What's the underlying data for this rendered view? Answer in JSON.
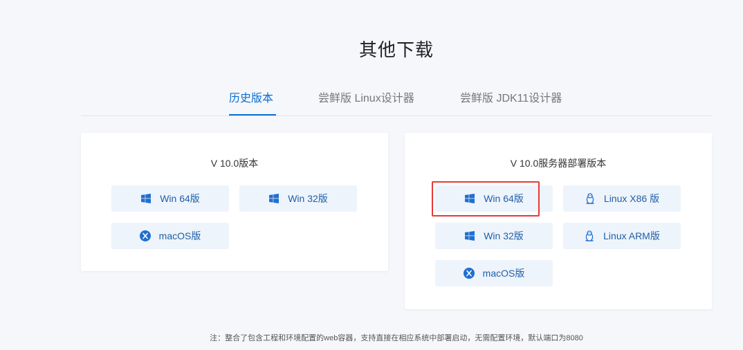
{
  "section_title": "其他下载",
  "tabs": [
    {
      "label": "历史版本"
    },
    {
      "label": "尝鲜版 Linux设计器"
    },
    {
      "label": "尝鲜版 JDK11设计器"
    }
  ],
  "left_card": {
    "title": "V 10.0版本",
    "buttons": [
      {
        "label": "Win 64版",
        "icon": "windows-icon"
      },
      {
        "label": "Win 32版",
        "icon": "windows-icon"
      },
      {
        "label": "macOS版",
        "icon": "macos-icon"
      }
    ]
  },
  "right_card": {
    "title": "V 10.0服务器部署版本",
    "buttons": [
      {
        "label": "Win 64版",
        "icon": "windows-icon"
      },
      {
        "label": "Linux X86 版",
        "icon": "linux-icon"
      },
      {
        "label": "Win 32版",
        "icon": "windows-icon"
      },
      {
        "label": "Linux ARM版",
        "icon": "linux-icon"
      },
      {
        "label": "macOS版",
        "icon": "macos-icon"
      }
    ]
  },
  "footnote": "注：整合了包含工程和环境配置的web容器，支持直接在相应系统中部署启动，无需配置环境，默认端口为8080",
  "colors": {
    "accent": "#0a6ed1",
    "button_bg": "#eef4fb",
    "highlight": "#e53935"
  }
}
